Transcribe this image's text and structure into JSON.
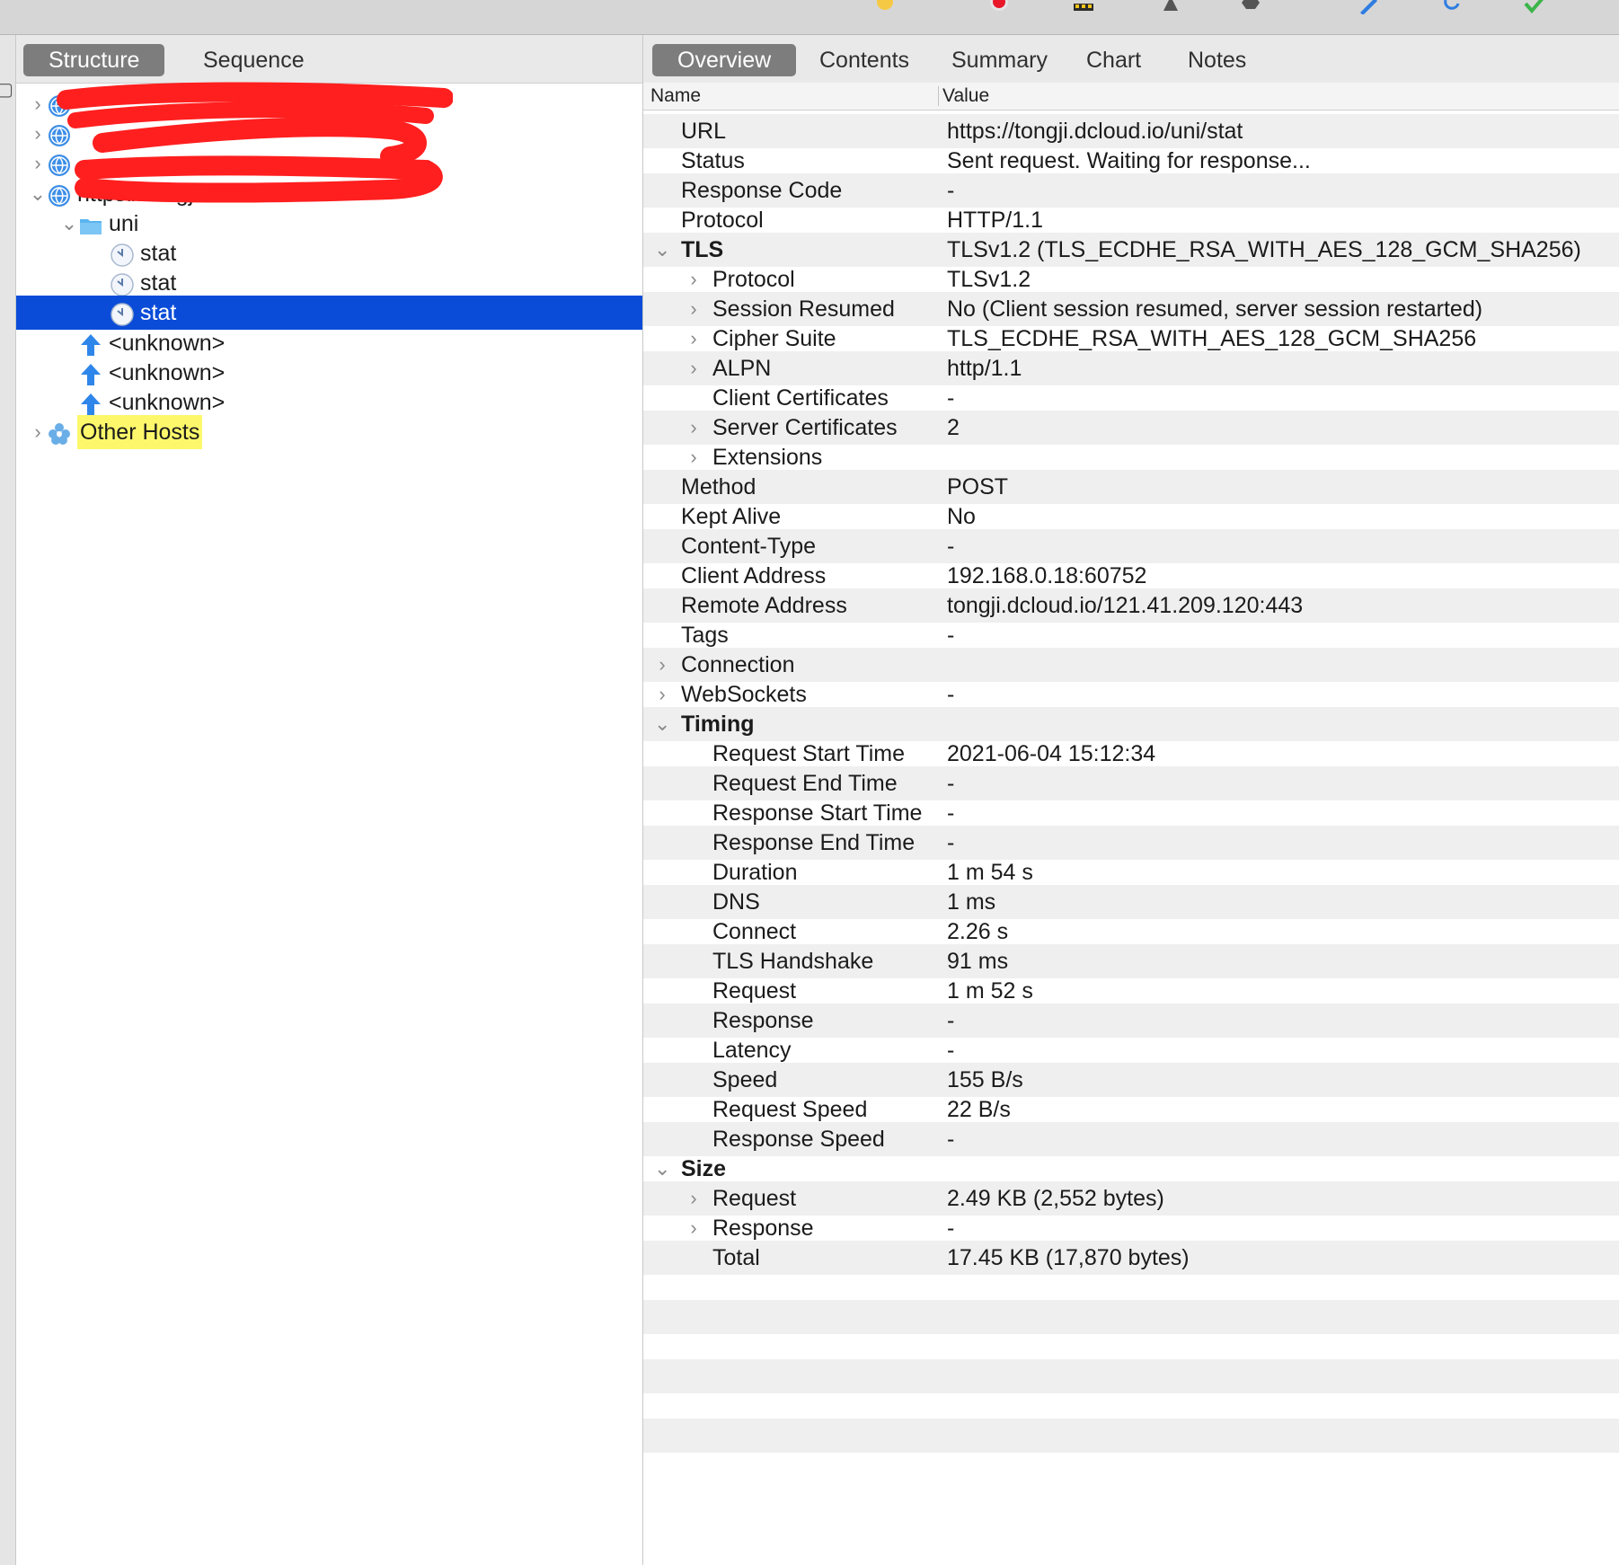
{
  "left_tabs": [
    {
      "label": "Structure",
      "active": true
    },
    {
      "label": "Sequence",
      "active": false
    }
  ],
  "right_tabs": [
    {
      "label": "Overview",
      "active": true
    },
    {
      "label": "Contents",
      "active": false
    },
    {
      "label": "Summary",
      "active": false
    },
    {
      "label": "Chart",
      "active": false
    },
    {
      "label": "Notes",
      "active": false
    }
  ],
  "columns": {
    "name": "Name",
    "value": "Value"
  },
  "tree": [
    {
      "label": "",
      "icon": "globe-icon",
      "disclosure": "collapsed",
      "indent": 0,
      "redacted": true
    },
    {
      "label": "",
      "icon": "globe-icon",
      "disclosure": "collapsed",
      "indent": 0,
      "redacted": true
    },
    {
      "label": "",
      "icon": "globe-icon",
      "disclosure": "collapsed",
      "indent": 0,
      "redacted": true
    },
    {
      "label": "https://tongji.dcloud.io",
      "icon": "globe-icon",
      "disclosure": "expanded",
      "indent": 0
    },
    {
      "label": "uni",
      "icon": "folder-icon",
      "disclosure": "expanded",
      "indent": 1
    },
    {
      "label": "stat",
      "icon": "clock-icon",
      "disclosure": "none",
      "indent": 2
    },
    {
      "label": "stat",
      "icon": "clock-icon",
      "disclosure": "none",
      "indent": 2
    },
    {
      "label": "stat",
      "icon": "clock-icon",
      "disclosure": "none",
      "indent": 2,
      "selected": true
    },
    {
      "label": "<unknown>",
      "icon": "upload-arrow-icon",
      "disclosure": "none",
      "indent": 1
    },
    {
      "label": "<unknown>",
      "icon": "upload-arrow-icon",
      "disclosure": "none",
      "indent": 1
    },
    {
      "label": "<unknown>",
      "icon": "upload-arrow-icon",
      "disclosure": "none",
      "indent": 1
    },
    {
      "label": "Other Hosts",
      "icon": "hosts-cluster-icon",
      "disclosure": "collapsed",
      "indent": 0,
      "highlight": true
    }
  ],
  "overview": [
    {
      "name": "URL",
      "value": "https://tongji.dcloud.io/uni/stat",
      "level": 0,
      "disclosure": "none"
    },
    {
      "name": "Status",
      "value": "Sent request. Waiting for response...",
      "level": 0,
      "disclosure": "none"
    },
    {
      "name": "Response Code",
      "value": "-",
      "level": 0,
      "disclosure": "none"
    },
    {
      "name": "Protocol",
      "value": "HTTP/1.1",
      "level": 0,
      "disclosure": "none"
    },
    {
      "name": "TLS",
      "value": "TLSv1.2 (TLS_ECDHE_RSA_WITH_AES_128_GCM_SHA256)",
      "level": 0,
      "disclosure": "expanded",
      "bold": true
    },
    {
      "name": "Protocol",
      "value": "TLSv1.2",
      "level": 1,
      "disclosure": "collapsed"
    },
    {
      "name": "Session Resumed",
      "value": "No (Client session resumed, server session restarted)",
      "level": 1,
      "disclosure": "collapsed"
    },
    {
      "name": "Cipher Suite",
      "value": "TLS_ECDHE_RSA_WITH_AES_128_GCM_SHA256",
      "level": 1,
      "disclosure": "collapsed"
    },
    {
      "name": "ALPN",
      "value": "http/1.1",
      "level": 1,
      "disclosure": "collapsed"
    },
    {
      "name": "Client Certificates",
      "value": "-",
      "level": 1,
      "disclosure": "none"
    },
    {
      "name": "Server Certificates",
      "value": "2",
      "level": 1,
      "disclosure": "collapsed"
    },
    {
      "name": "Extensions",
      "value": "",
      "level": 1,
      "disclosure": "collapsed"
    },
    {
      "name": "Method",
      "value": "POST",
      "level": 0,
      "disclosure": "none"
    },
    {
      "name": "Kept Alive",
      "value": "No",
      "level": 0,
      "disclosure": "none"
    },
    {
      "name": "Content-Type",
      "value": "-",
      "level": 0,
      "disclosure": "none"
    },
    {
      "name": "Client Address",
      "value": "192.168.0.18:60752",
      "level": 0,
      "disclosure": "none"
    },
    {
      "name": "Remote Address",
      "value": "tongji.dcloud.io/121.41.209.120:443",
      "level": 0,
      "disclosure": "none"
    },
    {
      "name": "Tags",
      "value": "-",
      "level": 0,
      "disclosure": "none"
    },
    {
      "name": "Connection",
      "value": "",
      "level": 0,
      "disclosure": "collapsed"
    },
    {
      "name": "WebSockets",
      "value": "-",
      "level": 0,
      "disclosure": "collapsed"
    },
    {
      "name": "Timing",
      "value": "",
      "level": 0,
      "disclosure": "expanded",
      "bold": true
    },
    {
      "name": "Request Start Time",
      "value": "2021-06-04 15:12:34",
      "level": 1,
      "disclosure": "none"
    },
    {
      "name": "Request End Time",
      "value": "-",
      "level": 1,
      "disclosure": "none"
    },
    {
      "name": "Response Start Time",
      "value": "-",
      "level": 1,
      "disclosure": "none"
    },
    {
      "name": "Response End Time",
      "value": "-",
      "level": 1,
      "disclosure": "none"
    },
    {
      "name": "Duration",
      "value": "1 m 54 s",
      "level": 1,
      "disclosure": "none"
    },
    {
      "name": "DNS",
      "value": "1 ms",
      "level": 1,
      "disclosure": "none"
    },
    {
      "name": "Connect",
      "value": "2.26 s",
      "level": 1,
      "disclosure": "none"
    },
    {
      "name": "TLS Handshake",
      "value": "91 ms",
      "level": 1,
      "disclosure": "none"
    },
    {
      "name": "Request",
      "value": "1 m 52 s",
      "level": 1,
      "disclosure": "none"
    },
    {
      "name": "Response",
      "value": "-",
      "level": 1,
      "disclosure": "none"
    },
    {
      "name": "Latency",
      "value": "-",
      "level": 1,
      "disclosure": "none"
    },
    {
      "name": "Speed",
      "value": "155 B/s",
      "level": 1,
      "disclosure": "none"
    },
    {
      "name": "Request Speed",
      "value": "22 B/s",
      "level": 1,
      "disclosure": "none"
    },
    {
      "name": "Response Speed",
      "value": "-",
      "level": 1,
      "disclosure": "none"
    },
    {
      "name": "Size",
      "value": "",
      "level": 0,
      "disclosure": "expanded",
      "bold": true
    },
    {
      "name": "Request",
      "value": "2.49 KB (2,552 bytes)",
      "level": 1,
      "disclosure": "collapsed"
    },
    {
      "name": "Response",
      "value": "-",
      "level": 1,
      "disclosure": "collapsed"
    },
    {
      "name": "Total",
      "value": "17.45 KB (17,870 bytes)",
      "level": 1,
      "disclosure": "none"
    }
  ],
  "colors": {
    "selection": "#0a4cd8",
    "highlight": "#fdf86b",
    "redaction": "#ff1f1f",
    "active_tab": "#7d7d7d"
  }
}
